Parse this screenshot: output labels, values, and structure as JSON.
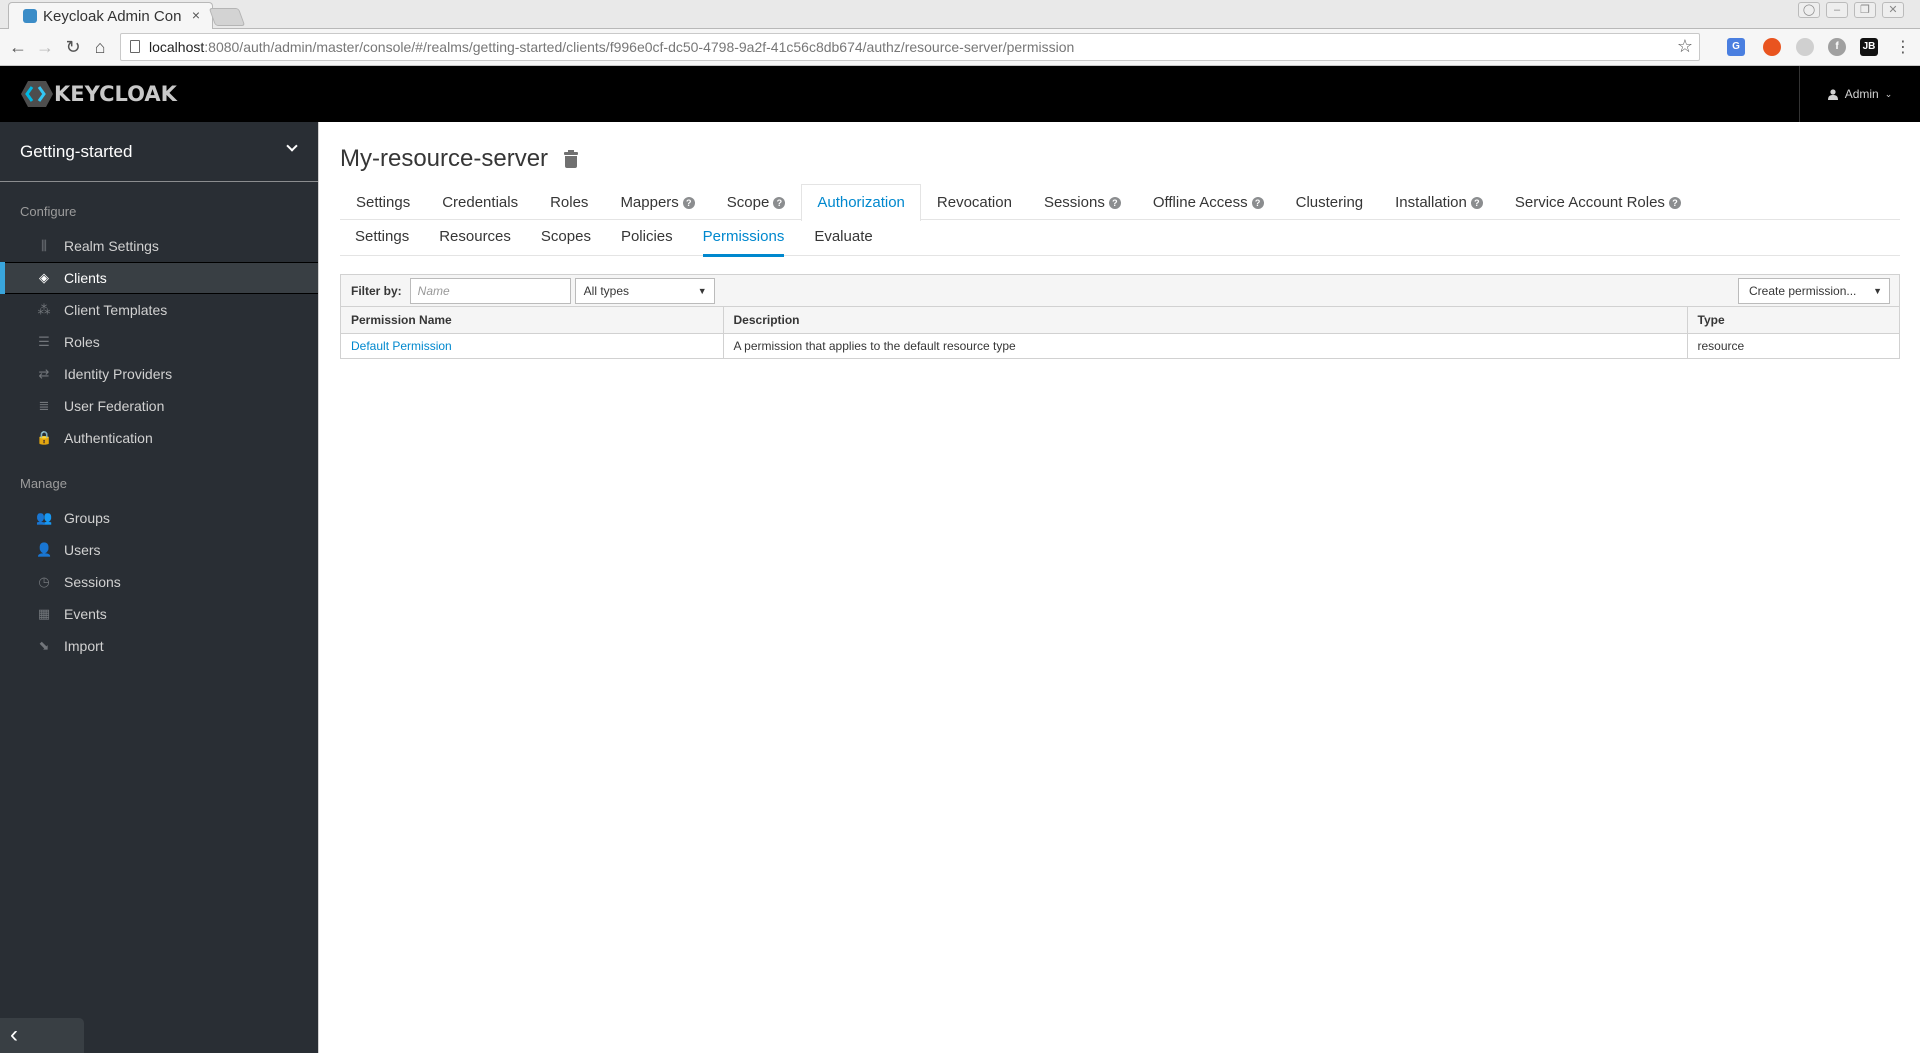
{
  "browser": {
    "tab_title": "Keycloak Admin Con",
    "close_glyph": "×",
    "url_host": "localhost",
    "url_rest": ":8080/auth/admin/master/console/#/realms/getting-started/clients/f996e0cf-dc50-4798-9a2f-41c56c8db674/authz/resource-server/permission",
    "extensions": [
      {
        "name": "google-translate",
        "label": "G",
        "color": "#4a7fe0"
      },
      {
        "name": "ubuntu",
        "label": "",
        "color": "#e9541f"
      },
      {
        "name": "spinner",
        "label": "",
        "color": "#d0d0d0"
      },
      {
        "name": "fedora",
        "label": "f",
        "color": "#a0a0a0"
      },
      {
        "name": "jetbrains",
        "label": "JB",
        "color": "#111111"
      }
    ]
  },
  "header": {
    "logo_text": "KEYCLOAK",
    "user_label": "Admin"
  },
  "sidebar": {
    "realm": "Getting-started",
    "configure_label": "Configure",
    "configure_items": [
      {
        "label": "Realm Settings",
        "icon": "sliders-icon",
        "glyph": "⫼",
        "active": false
      },
      {
        "label": "Clients",
        "icon": "cube-icon",
        "glyph": "◈",
        "active": true
      },
      {
        "label": "Client Templates",
        "icon": "cubes-icon",
        "glyph": "⁂",
        "active": false
      },
      {
        "label": "Roles",
        "icon": "server-icon",
        "glyph": "☰",
        "active": false
      },
      {
        "label": "Identity Providers",
        "icon": "exchange-icon",
        "glyph": "⇄",
        "active": false
      },
      {
        "label": "User Federation",
        "icon": "database-icon",
        "glyph": "≣",
        "active": false
      },
      {
        "label": "Authentication",
        "icon": "lock-icon",
        "glyph": "🔒",
        "active": false
      }
    ],
    "manage_label": "Manage",
    "manage_items": [
      {
        "label": "Groups",
        "icon": "users-icon",
        "glyph": "👥"
      },
      {
        "label": "Users",
        "icon": "user-icon",
        "glyph": "👤"
      },
      {
        "label": "Sessions",
        "icon": "clock-icon",
        "glyph": "◷"
      },
      {
        "label": "Events",
        "icon": "calendar-icon",
        "glyph": "▦"
      },
      {
        "label": "Import",
        "icon": "import-icon",
        "glyph": "⬊"
      }
    ],
    "collapse_glyph": "‹"
  },
  "main": {
    "title": "My-resource-server",
    "tabs": [
      {
        "label": "Settings",
        "help": false,
        "active": false
      },
      {
        "label": "Credentials",
        "help": false,
        "active": false
      },
      {
        "label": "Roles",
        "help": false,
        "active": false
      },
      {
        "label": "Mappers",
        "help": true,
        "active": false
      },
      {
        "label": "Scope",
        "help": true,
        "active": false
      },
      {
        "label": "Authorization",
        "help": false,
        "active": true
      },
      {
        "label": "Revocation",
        "help": false,
        "active": false
      },
      {
        "label": "Sessions",
        "help": true,
        "active": false
      },
      {
        "label": "Offline Access",
        "help": true,
        "active": false
      },
      {
        "label": "Clustering",
        "help": false,
        "active": false
      },
      {
        "label": "Installation",
        "help": true,
        "active": false
      },
      {
        "label": "Service Account Roles",
        "help": true,
        "active": false
      }
    ],
    "subtabs": [
      {
        "label": "Settings",
        "active": false
      },
      {
        "label": "Resources",
        "active": false
      },
      {
        "label": "Scopes",
        "active": false
      },
      {
        "label": "Policies",
        "active": false
      },
      {
        "label": "Permissions",
        "active": true
      },
      {
        "label": "Evaluate",
        "active": false
      }
    ],
    "filter": {
      "label": "Filter by:",
      "name_placeholder": "Name",
      "name_value": "",
      "type_selected": "All types",
      "create_label": "Create permission..."
    },
    "table": {
      "columns": [
        "Permission Name",
        "Description",
        "Type"
      ],
      "rows": [
        {
          "name": "Default Permission",
          "description": "A permission that applies to the default resource type",
          "type": "resource"
        }
      ]
    }
  }
}
